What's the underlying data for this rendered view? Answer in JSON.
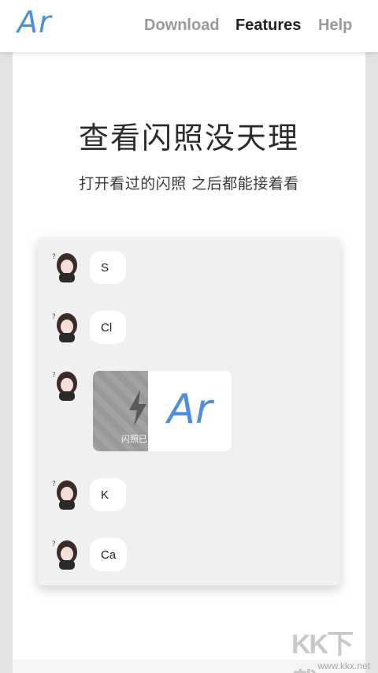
{
  "header": {
    "logo": "Ar",
    "nav": [
      {
        "label": "Download",
        "active": false
      },
      {
        "label": "Features",
        "active": true
      },
      {
        "label": "Help",
        "active": false
      }
    ]
  },
  "hero": {
    "title": "查看闪照没天理",
    "subtitle": "打开看过的闪照 之后都能接着看"
  },
  "chat": {
    "messages": [
      {
        "text": "S"
      },
      {
        "text": "Cl"
      },
      {
        "type": "flash-photo",
        "caption": "闪照已",
        "overlay_logo": "Ar"
      },
      {
        "text": "K"
      },
      {
        "text": "Ca"
      }
    ]
  },
  "watermark": {
    "brand": "KK下载",
    "url": "www.kkx.net"
  },
  "colors": {
    "accent": "#4a8fe0",
    "panel": "#f0f0f0",
    "bubble": "#ffffff"
  }
}
